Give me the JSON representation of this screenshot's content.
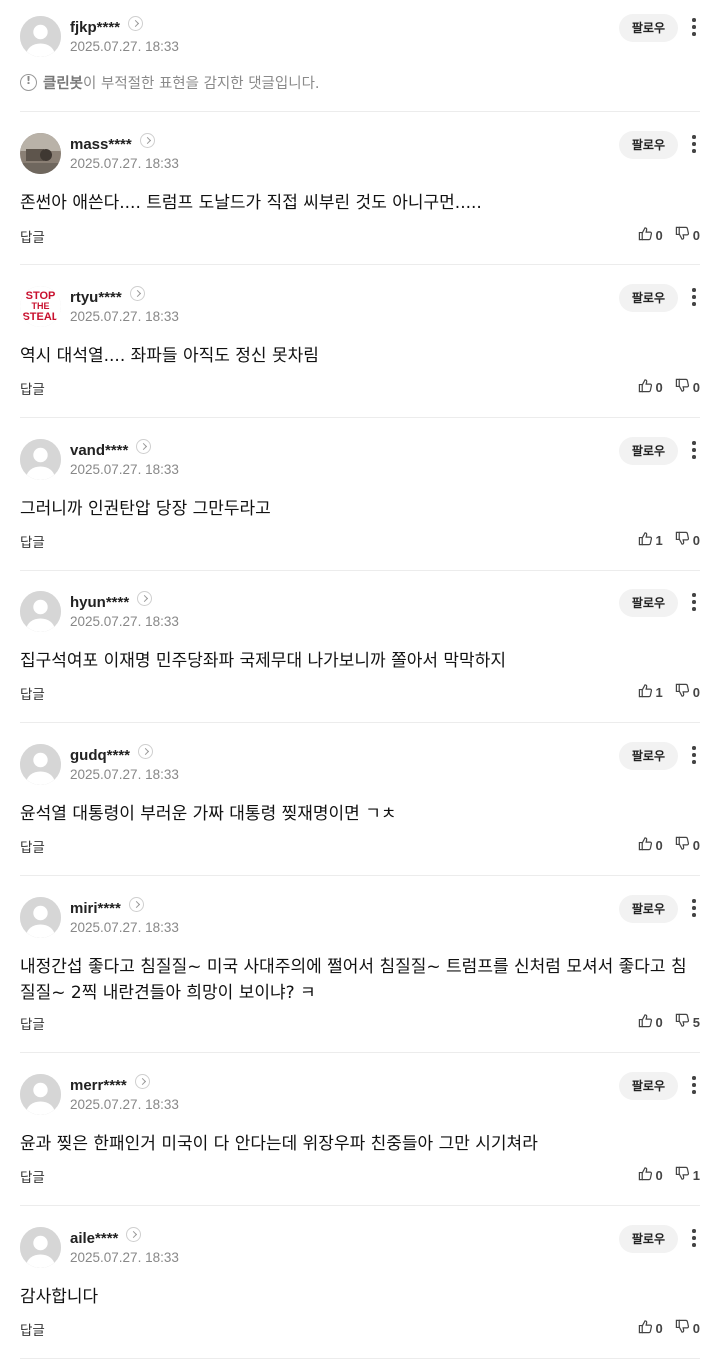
{
  "ui": {
    "follow_label": "팔로우",
    "reply_label": "답글",
    "cleanbot": {
      "name": "클린봇",
      "message": "이 부적절한 표현을 감지한 댓글입니다."
    }
  },
  "comments": [
    {
      "nickname": "fjkp****",
      "date": "2025.07.27. 18:33",
      "avatar": "default",
      "hidden": true
    },
    {
      "nickname": "mass****",
      "date": "2025.07.27. 18:33",
      "avatar": "photo",
      "text": "존썬아 애쓴다.... 트럼프 도날드가 직접 씨부린 것도 아니구먼.....",
      "likes": "0",
      "dislikes": "0"
    },
    {
      "nickname": "rtyu****",
      "date": "2025.07.27. 18:33",
      "avatar": "stop-the-steal",
      "text": "역시 대석열.... 좌파들 아직도 정신 못차림",
      "likes": "0",
      "dislikes": "0"
    },
    {
      "nickname": "vand****",
      "date": "2025.07.27. 18:33",
      "avatar": "default",
      "text": "그러니까 인권탄압 당장 그만두라고",
      "likes": "1",
      "dislikes": "0"
    },
    {
      "nickname": "hyun****",
      "date": "2025.07.27. 18:33",
      "avatar": "default",
      "text": "집구석여포 이재명 민주당좌파 국제무대 나가보니까 쫄아서 막막하지",
      "likes": "1",
      "dislikes": "0"
    },
    {
      "nickname": "gudq****",
      "date": "2025.07.27. 18:33",
      "avatar": "default",
      "text": "윤석열 대통령이 부러운 가짜 대통령 찢재명이면 ㄱㅊ",
      "likes": "0",
      "dislikes": "0"
    },
    {
      "nickname": "miri****",
      "date": "2025.07.27. 18:33",
      "avatar": "default",
      "text": "내정간섭 좋다고 침질질~ 미국 사대주의에 쩔어서 침질질~ 트럼프를 신처럼 모셔서 좋다고 침질질~ 2찍 내란견들아 희망이 보이냐? ㅋ",
      "likes": "0",
      "dislikes": "5"
    },
    {
      "nickname": "merr****",
      "date": "2025.07.27. 18:33",
      "avatar": "default",
      "text": "윤과 찢은 한패인거 미국이 다 안다는데 위장우파 친중들아 그만 시기쳐라",
      "likes": "0",
      "dislikes": "1"
    },
    {
      "nickname": "aile****",
      "date": "2025.07.27. 18:33",
      "avatar": "default",
      "text": "감사합니다",
      "likes": "0",
      "dislikes": "0"
    }
  ],
  "avatar_logo_text": {
    "line1": "STOP",
    "line2": "THE",
    "line3": "STEAL"
  },
  "colors": {
    "follow_bg": "#f2f2f2",
    "date": "#888888",
    "divider": "#ececec",
    "logo_red": "#c8102e"
  }
}
